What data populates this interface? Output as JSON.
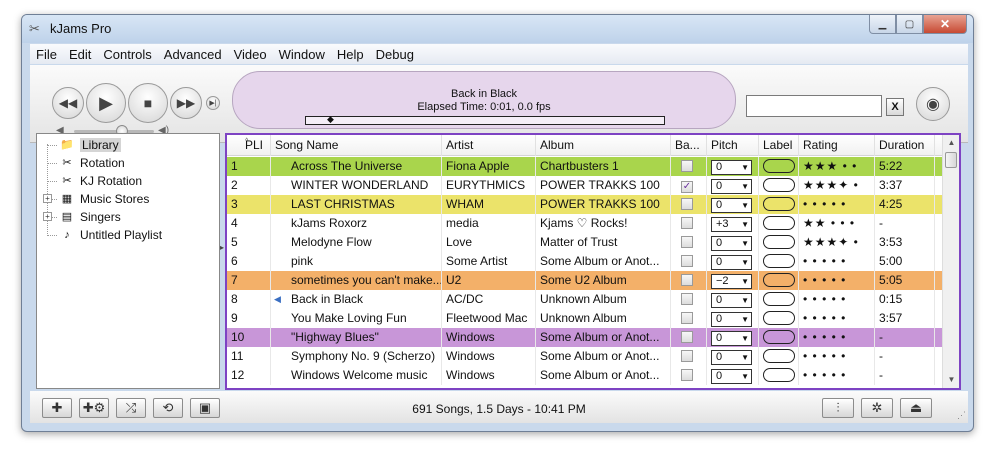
{
  "window": {
    "title": "kJams Pro"
  },
  "menu": [
    "File",
    "Edit",
    "Controls",
    "Advanced",
    "Video",
    "Window",
    "Help",
    "Debug"
  ],
  "now_playing": {
    "title": "Back in Black",
    "elapsed": "Elapsed Time: 0:01, 0.0 fps",
    "progress": 0.07
  },
  "search": {
    "value": "",
    "clear_label": "X"
  },
  "sidebar": {
    "items": [
      {
        "label": "Library",
        "icon": "library-icon",
        "glyph": "📁",
        "selected": true,
        "expander": ""
      },
      {
        "label": "Rotation",
        "icon": "rotation-icon",
        "glyph": "✂",
        "selected": false,
        "expander": ""
      },
      {
        "label": "KJ Rotation",
        "icon": "kj-rotation-icon",
        "glyph": "✂",
        "selected": false,
        "expander": ""
      },
      {
        "label": "Music Stores",
        "icon": "music-store-icon",
        "glyph": "▦",
        "selected": false,
        "expander": "+"
      },
      {
        "label": "Singers",
        "icon": "singers-icon",
        "glyph": "▤",
        "selected": false,
        "expander": "+"
      },
      {
        "label": "Untitled Playlist",
        "icon": "playlist-icon",
        "glyph": "♪",
        "selected": false,
        "expander": ""
      }
    ]
  },
  "table": {
    "headers": [
      "PLI",
      "Song Name",
      "Artist",
      "Album",
      "Ba...",
      "Pitch",
      "Label",
      "Rating",
      "Duration"
    ],
    "rows": [
      {
        "pli": "1",
        "song": "Across The Universe",
        "artist": "Fiona Apple",
        "album": "Chartbusters 1",
        "checked": false,
        "pitch": "0",
        "label_color": "#a9d54c",
        "rating": "★★★ • •",
        "duration": "5:22",
        "bg": "#a9d54c",
        "playing": false
      },
      {
        "pli": "2",
        "song": "WINTER WONDERLAND",
        "artist": "EURYTHMICS",
        "album": "POWER TRAKKS 100",
        "checked": true,
        "pitch": "0",
        "label_color": "#ffffff",
        "rating": "★★★✦ •",
        "duration": "3:37",
        "bg": "#ffffff",
        "playing": false
      },
      {
        "pli": "3",
        "song": "LAST CHRISTMAS",
        "artist": "WHAM",
        "album": "POWER TRAKKS 100",
        "checked": false,
        "pitch": "0",
        "label_color": "#ebe36a",
        "rating": "• • • • •",
        "duration": "4:25",
        "bg": "#ebe36a",
        "playing": false
      },
      {
        "pli": "4",
        "song": "kJams Roxorz",
        "artist": "media",
        "album": "Kjams ♡ Rocks!",
        "checked": false,
        "pitch": "+3",
        "label_color": "#ffffff",
        "rating": "★★ • • •",
        "duration": "-",
        "bg": "#ffffff",
        "playing": false
      },
      {
        "pli": "5",
        "song": "Melodyne Flow",
        "artist": "Love",
        "album": "Matter of Trust",
        "checked": false,
        "pitch": "0",
        "label_color": "#ffffff",
        "rating": "★★★✦ •",
        "duration": "3:53",
        "bg": "#ffffff",
        "playing": false
      },
      {
        "pli": "6",
        "song": "pink",
        "artist": "Some Artist",
        "album": "Some Album or Anot...",
        "checked": false,
        "pitch": "0",
        "label_color": "#ffffff",
        "rating": "• • • • •",
        "duration": "5:00",
        "bg": "#ffffff",
        "playing": false
      },
      {
        "pli": "7",
        "song": "sometimes you can't make...",
        "artist": "U2",
        "album": "Some U2 Album",
        "checked": false,
        "pitch": "−2",
        "label_color": "#f3b069",
        "rating": "• • • • •",
        "duration": "5:05",
        "bg": "#f3b069",
        "playing": false
      },
      {
        "pli": "8",
        "song": "Back in Black",
        "artist": "AC/DC",
        "album": "Unknown Album",
        "checked": false,
        "pitch": "0",
        "label_color": "#ffffff",
        "rating": "• • • • •",
        "duration": "0:15",
        "bg": "#ffffff",
        "playing": true
      },
      {
        "pli": "9",
        "song": "You Make Loving Fun",
        "artist": "Fleetwood Mac",
        "album": "Unknown Album",
        "checked": false,
        "pitch": "0",
        "label_color": "#ffffff",
        "rating": "• • • • •",
        "duration": "3:57",
        "bg": "#ffffff",
        "playing": false
      },
      {
        "pli": "10",
        "song": "\"Highway Blues\"",
        "artist": "Windows",
        "album": "Some Album or Anot...",
        "checked": false,
        "pitch": "0",
        "label_color": "#c896d8",
        "rating": "• • • • •",
        "duration": "-",
        "bg": "#c896d8",
        "playing": false
      },
      {
        "pli": "11",
        "song": "Symphony No. 9 (Scherzo)",
        "artist": "Windows",
        "album": "Some Album or Anot...",
        "checked": false,
        "pitch": "0",
        "label_color": "#ffffff",
        "rating": "• • • • •",
        "duration": "-",
        "bg": "#ffffff",
        "playing": false
      },
      {
        "pli": "12",
        "song": "Windows Welcome music",
        "artist": "Windows",
        "album": "Some Album or Anot...",
        "checked": false,
        "pitch": "0",
        "label_color": "#ffffff",
        "rating": "• • • • •",
        "duration": "-",
        "bg": "#ffffff",
        "playing": false
      }
    ]
  },
  "status": {
    "text": "691 Songs, 1.5 Days - 10:41 PM"
  },
  "colors": {
    "selection_border": "#7e43c3",
    "lcd_background": "#e6d6ec"
  }
}
